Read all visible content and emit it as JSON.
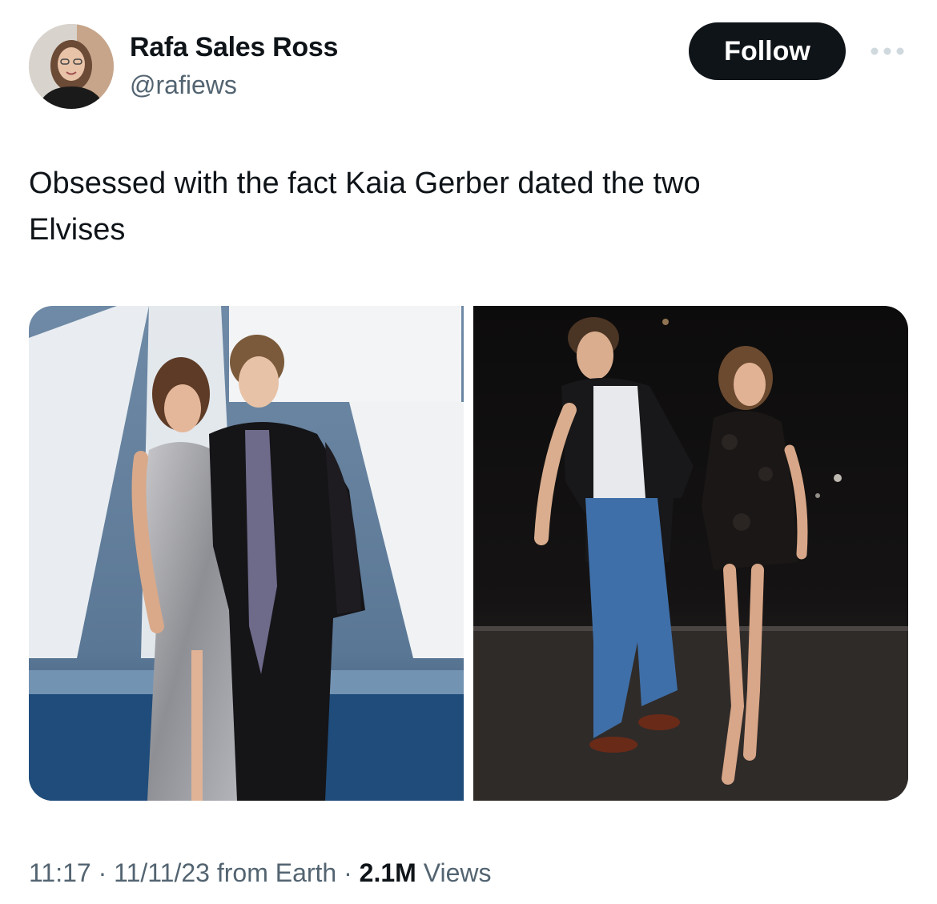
{
  "author": {
    "display_name": "Rafa Sales Ross",
    "handle": "@rafiews",
    "avatar_icon": "profile-photo-avatar"
  },
  "actions": {
    "follow_label": "Follow",
    "more_icon": "more-horizontal-icon"
  },
  "tweet": {
    "text": "Obsessed with the fact Kaia Gerber dated the two\nElvises"
  },
  "media": {
    "items": [
      {
        "description_icon": "photo-red-carpet"
      },
      {
        "description_icon": "photo-night-street"
      }
    ]
  },
  "meta": {
    "time": "11:17",
    "separator": " · ",
    "date": "11/11/23",
    "source": "from Earth",
    "views_count": "2.1M",
    "views_label": "Views"
  },
  "colors": {
    "text_primary": "#0f1419",
    "text_secondary": "#536471",
    "button_bg": "#0f1419"
  }
}
